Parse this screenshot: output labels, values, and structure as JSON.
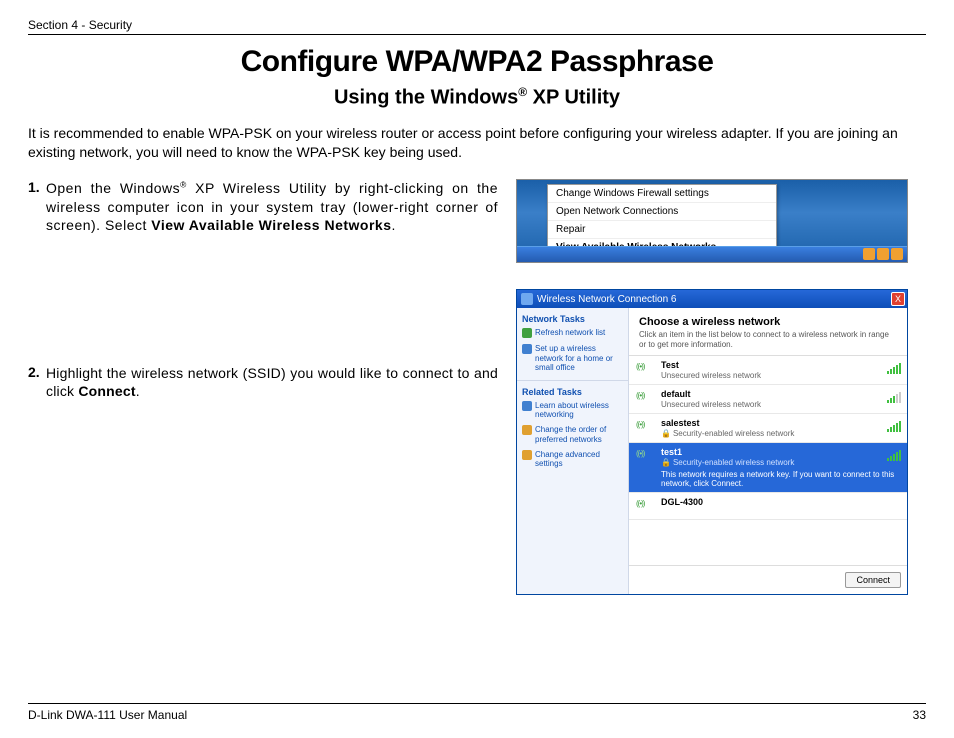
{
  "header": {
    "section": "Section 4 - Security"
  },
  "title": "Configure WPA/WPA2 Passphrase",
  "subtitle_pre": "Using the Windows",
  "subtitle_post": " XP Utility",
  "intro": "It is recommended to enable WPA-PSK on your wireless router or access point before configuring your wireless adapter. If you are joining an existing network, you will need to know the WPA-PSK key being used.",
  "steps": {
    "s1": {
      "num": "1.",
      "pre": "Open the Windows",
      "mid": " XP Wireless Utility by right-clicking on the wireless computer icon in your system tray (lower-right corner of screen). Select ",
      "bold": "View Available Wireless Networks",
      "post": "."
    },
    "s2": {
      "num": "2.",
      "pre": "Highlight the wireless network (SSID) you would like to connect to and click ",
      "bold": "Connect",
      "post": "."
    }
  },
  "shot1_menu": {
    "i1": "Change Windows Firewall settings",
    "i2": "Open Network Connections",
    "i3": "Repair",
    "i4": "View Available Wireless Networks"
  },
  "shot2": {
    "title": "Wireless Network Connection 6",
    "close": "X",
    "side": {
      "h1": "Network Tasks",
      "l1": "Refresh network list",
      "l2": "Set up a wireless network for a home or small office",
      "h2": "Related Tasks",
      "l3": "Learn about wireless networking",
      "l4": "Change the order of preferred networks",
      "l5": "Change advanced settings"
    },
    "main": {
      "head": "Choose a wireless network",
      "sub": "Click an item in the list below to connect to a wireless network in range or to get more information.",
      "nets": {
        "n1": {
          "name": "Test",
          "type": "Unsecured wireless network"
        },
        "n2": {
          "name": "default",
          "type": "Unsecured wireless network"
        },
        "n3": {
          "name": "salestest",
          "type": "Security-enabled wireless network"
        },
        "n4": {
          "name": "test1",
          "type": "Security-enabled wireless network",
          "note": "This network requires a network key. If you want to connect to this network, click Connect."
        },
        "n5": {
          "name": "DGL-4300",
          "type": ""
        }
      },
      "connect": "Connect"
    }
  },
  "footer": {
    "left": "D-Link DWA-111 User Manual",
    "right": "33"
  }
}
